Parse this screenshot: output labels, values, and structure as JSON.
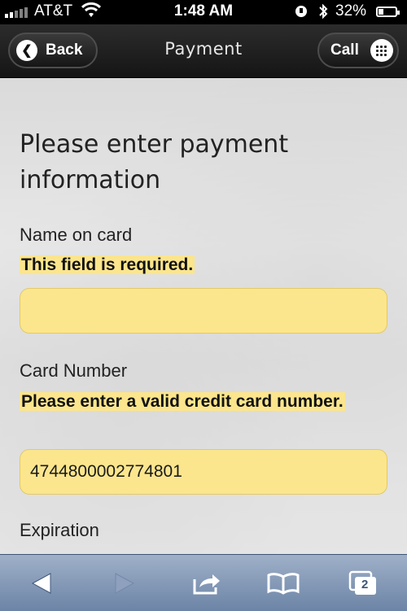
{
  "status_bar": {
    "carrier": "AT&T",
    "time": "1:48 AM",
    "battery_percent": "32%",
    "battery_level": 0.32,
    "icons": [
      "signal-icon",
      "wifi-icon",
      "rotation-lock-icon",
      "bluetooth-icon",
      "battery-icon"
    ]
  },
  "nav": {
    "back_label": "Back",
    "title": "Payment",
    "call_label": "Call"
  },
  "form": {
    "heading": "Please enter payment information",
    "name_label": "Name on card",
    "name_error": "This field is required.",
    "name_value": "",
    "card_label": "Card Number",
    "card_error": "Please enter a valid credit card number.",
    "card_value": "4744800002774801",
    "expiration_label": "Expiration"
  },
  "toolbar": {
    "tabs_count": "2",
    "icons": [
      "back-arrow-icon",
      "forward-arrow-icon",
      "share-icon",
      "bookmarks-icon",
      "tabs-icon"
    ]
  },
  "colors": {
    "error_highlight": "#fbe58d",
    "toolbar": "#8a9cb8",
    "navbar": "#1e1e1e"
  }
}
